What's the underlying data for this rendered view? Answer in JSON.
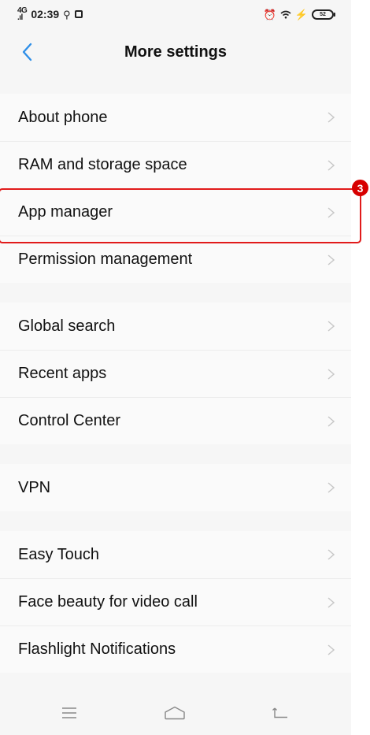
{
  "status_bar": {
    "network_label": "4G",
    "time": "02:39",
    "battery_level": "52",
    "icons": [
      "signal-icon",
      "usb-icon",
      "photo-icon",
      "alarm-icon",
      "wifi-icon",
      "charging-icon",
      "battery-icon"
    ]
  },
  "header": {
    "title": "More settings",
    "back_icon": "back-chevron-icon"
  },
  "groups": [
    {
      "items": [
        {
          "label": "About phone"
        },
        {
          "label": "RAM and storage space"
        },
        {
          "label": "App manager"
        },
        {
          "label": "Permission management"
        }
      ]
    },
    {
      "items": [
        {
          "label": "Global search"
        },
        {
          "label": "Recent apps"
        },
        {
          "label": "Control Center"
        }
      ]
    },
    {
      "items": [
        {
          "label": "VPN"
        }
      ]
    },
    {
      "items": [
        {
          "label": "Easy Touch"
        },
        {
          "label": "Face beauty for video call"
        },
        {
          "label": "Flashlight Notifications"
        }
      ]
    }
  ],
  "annotation": {
    "step_number": "3",
    "color": "#e11b1b"
  },
  "nav_bar": {
    "icons": [
      "menu-icon",
      "home-icon",
      "back-icon"
    ]
  }
}
